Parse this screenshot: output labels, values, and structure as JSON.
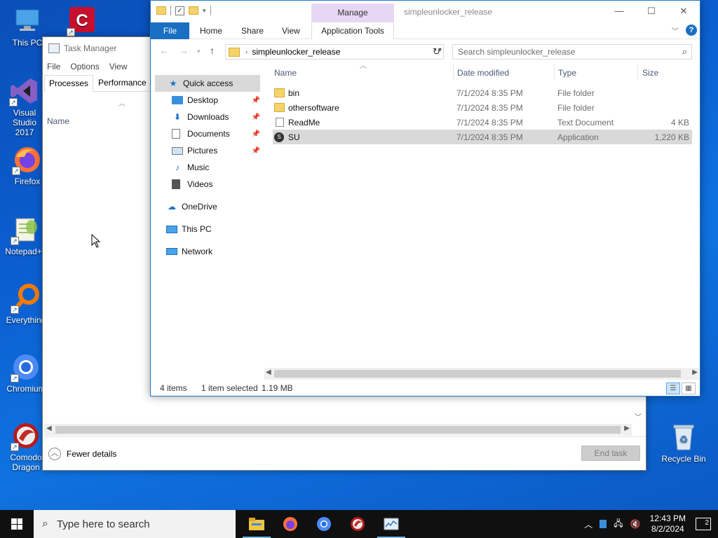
{
  "desktop": {
    "icons": [
      {
        "label": "This PC"
      },
      {
        "label": "Visual Studio 2017"
      },
      {
        "label": "Firefox"
      },
      {
        "label": "Notepad++"
      },
      {
        "label": "Everything"
      },
      {
        "label": "Chromium"
      },
      {
        "label": "Comodo Dragon"
      },
      {
        "label": "Recycle Bin"
      }
    ]
  },
  "task_manager": {
    "title": "Task Manager",
    "menu": [
      "File",
      "Options",
      "View"
    ],
    "tabs": [
      "Processes",
      "Performance"
    ],
    "column_name": "Name",
    "fewer_details": "Fewer details",
    "end_task": "End task"
  },
  "explorer": {
    "title": "simpleunlocker_release",
    "manage_tab": "Manage",
    "ribbon_tabs": {
      "file": "File",
      "home": "Home",
      "share": "Share",
      "view": "View",
      "app_tools": "Application Tools"
    },
    "address": "simpleunlocker_release",
    "search_placeholder": "Search simpleunlocker_release",
    "nav": {
      "quick_access": "Quick access",
      "desktop": "Desktop",
      "downloads": "Downloads",
      "documents": "Documents",
      "pictures": "Pictures",
      "music": "Music",
      "videos": "Videos",
      "onedrive": "OneDrive",
      "this_pc": "This PC",
      "network": "Network"
    },
    "columns": {
      "name": "Name",
      "date": "Date modified",
      "type": "Type",
      "size": "Size"
    },
    "files": [
      {
        "name": "bin",
        "date": "7/1/2024 8:35 PM",
        "type": "File folder",
        "size": ""
      },
      {
        "name": "othersoftware",
        "date": "7/1/2024 8:35 PM",
        "type": "File folder",
        "size": ""
      },
      {
        "name": "ReadMe",
        "date": "7/1/2024 8:35 PM",
        "type": "Text Document",
        "size": "4 KB"
      },
      {
        "name": "SU",
        "date": "7/1/2024 8:35 PM",
        "type": "Application",
        "size": "1,220 KB"
      }
    ],
    "status": {
      "items": "4 items",
      "selected": "1 item selected",
      "size": "1.19 MB"
    }
  },
  "taskbar": {
    "search_placeholder": "Type here to search",
    "time": "12:43 PM",
    "date": "8/2/2024",
    "notifications": "2"
  }
}
